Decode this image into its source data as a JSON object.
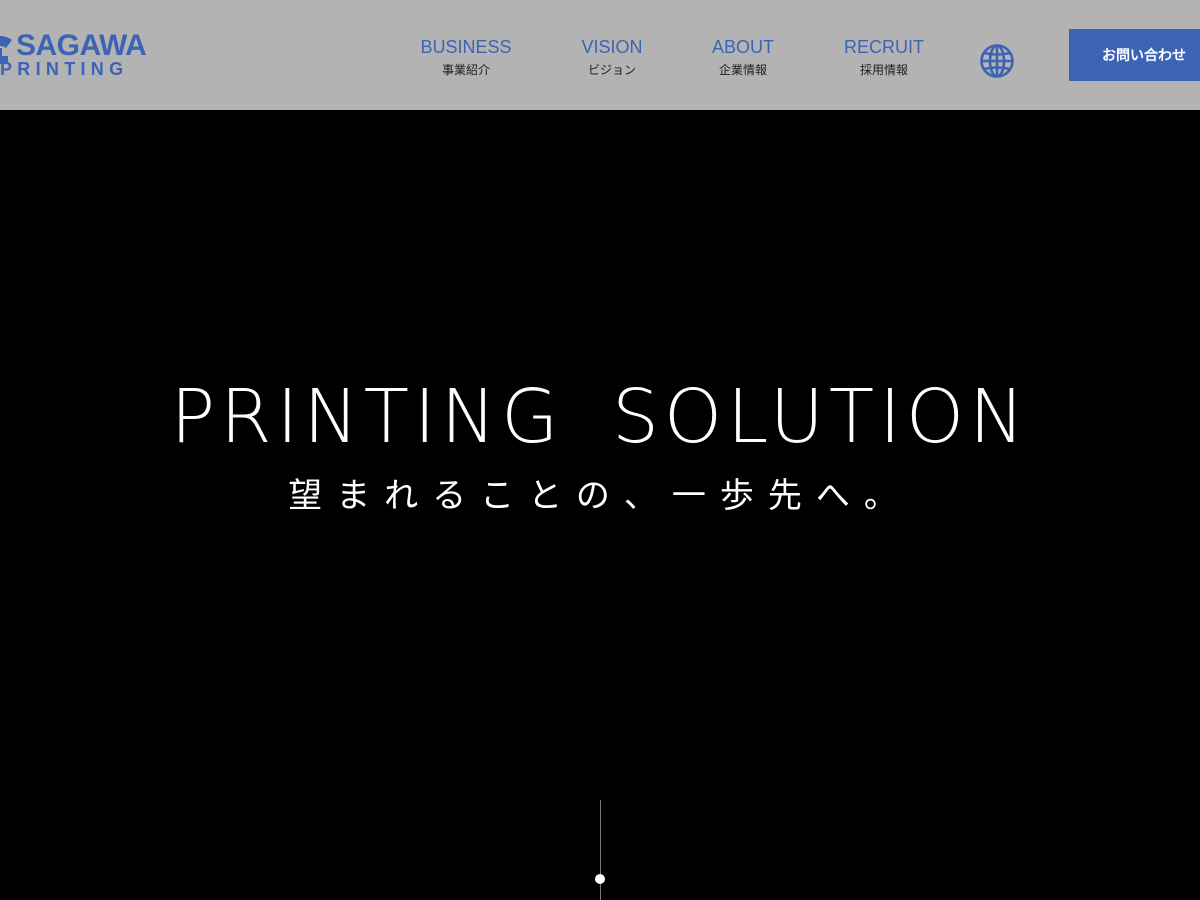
{
  "header": {
    "logo": {
      "line1": "SAGAWA",
      "line2": "PRINTING"
    },
    "nav": [
      {
        "en": "BUSINESS",
        "jp": "事業紹介"
      },
      {
        "en": "VISION",
        "jp": "ビジョン"
      },
      {
        "en": "ABOUT",
        "jp": "企業情報"
      },
      {
        "en": "RECRUIT",
        "jp": "採用情報"
      }
    ],
    "globe_icon": "globe-icon",
    "contact_label": "お問い合わせ"
  },
  "hero": {
    "title": "PRINTING SOLUTION",
    "subtitle": "望まれることの、一歩先へ。"
  },
  "colors": {
    "brand": "#3d64b4",
    "header_bg": "#b3b3b3",
    "hero_bg": "#000000",
    "text_light": "#ffffff"
  }
}
